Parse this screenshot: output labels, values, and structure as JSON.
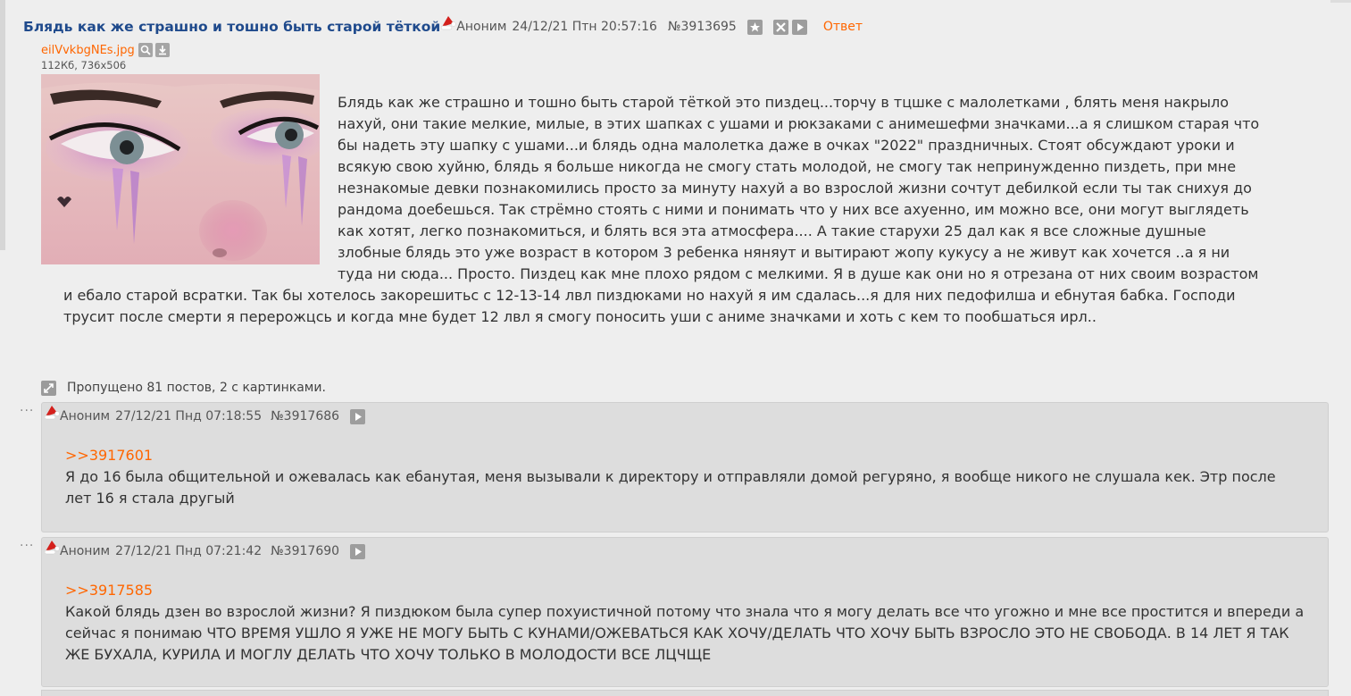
{
  "op": {
    "title": "Блядь как же страшно и тошно быть старой тёткой",
    "author": "Аноним",
    "date": "24/12/21 Птн 20:57:16",
    "post_number": "№3913695",
    "reply_label": "Ответ",
    "icons": [
      "star-icon",
      "hide-icon",
      "play-icon"
    ],
    "file": {
      "name": "eilVvkbgNEs.jpg",
      "meta": "112Кб, 736x506"
    },
    "text": "Блядь как же страшно и тошно быть старой тёткой это пиздец...торчу в тцшке с малолетками , блять меня накрыло нахуй, они такие мелкие, милые, в этих шапках с ушами и рюкзаками с анимешефми значками...а я слишком старая что бы надеть эту шапку с ушами...и блядь одна малолетка даже в очках \"2022\" праздничных. Стоят обсуждают уроки и всякую свою хуйню, блядь я больше никогда не смогу стать молодой, не смогу так непринужденно пиздеть, при мне незнакомые девки познакомились просто за минуту нахуй а во взрослой жизни сочтут дебилкой если ты так снихуя до рандома доебешься. Так стрёмно стоять с ними и понимать что у них все ахуенно, им можно все, они могут выглядеть как хотят, легко познакомиться, и блять вся эта атмосфера.... А такие старухи 25 дал как я все сложные душные злобные блядь это уже возраст в котором 3 ребенка няняут и вытирают жопу кукусу а не живут как хочется ..а я ни туда ни сюда... Просто. Пиздец как мне плохо рядом с мелкими. Я в душе как они но я отрезана от них своим возрастом и ебало старой всратки. Так бы хотелось закорешитьс с 12-13-14 лвл пиздюками но нахуй я им сдалась...я для них педофилша и ебнутая бабка. Господи трусит после смерти я перерожцсь и когда мне будет 12 лвл я смогу поносить уши с аниме значками и хоть с кем то пообшаться ирл.."
  },
  "skipped_text": "Пропущено 81 постов, 2 с картинками.",
  "replies": [
    {
      "author": "Аноним",
      "date": "27/12/21 Пнд 07:18:55",
      "post_number": "№3917686",
      "quote": ">>3917601",
      "text": "Я до 16 была общительной и ожевалась как ебанутая, меня вызывали к директору и отправляли домой регуряно, я вообще никого не слушала кек. Этр после лет 16 я стала другый"
    },
    {
      "author": "Аноним",
      "date": "27/12/21 Пнд 07:21:42",
      "post_number": "№3917690",
      "quote": ">>3917585",
      "text": "Какой блядь дзен во взрослой жизни? Я пиздюком была супер похуистичной потому что знала что я могу делать все что угожно и мне все простится и впереди а сейчас я понимаю ЧТО ВРЕМЯ УШЛО Я УЖЕ НЕ МОГУ БЫТЬ С КУНАМИ/ОЖЕВАТЬСЯ КАК ХОЧУ/ДЕЛАТЬ ЧТО ХОЧУ БЫТЬ ВЗРОСЛО ЭТО НЕ СВОБОДА. В 14 ЛЕТ Я ТАК ЖЕ БУХАЛА, КУРИЛА И МОГЛУ ДЕЛАТЬ ЧТО ХОЧУ ТОЛЬКО В МОЛОДОСТИ ВСЕ ЛЦЧЩЕ"
    }
  ],
  "colors": {
    "background": "#eeeeee",
    "title": "#1f4a8c",
    "accent": "#ff6600",
    "reply_bg": "#dddddd"
  }
}
